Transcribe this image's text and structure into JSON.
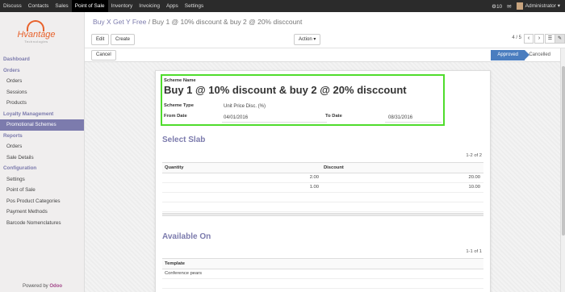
{
  "topbar": {
    "menu": [
      "Discuss",
      "Contacts",
      "Sales",
      "Point of Sale",
      "Inventory",
      "Invoicing",
      "Apps",
      "Settings"
    ],
    "active_index": 3,
    "notifications": "10",
    "user": "Administrator"
  },
  "logo": {
    "name": "Hvantage",
    "sub": "Technologies"
  },
  "sidebar": {
    "items": [
      {
        "label": "Dashboard",
        "kind": "section"
      },
      {
        "label": "Orders",
        "kind": "head"
      },
      {
        "label": "Orders",
        "kind": "item"
      },
      {
        "label": "Sessions",
        "kind": "item"
      },
      {
        "label": "Products",
        "kind": "item"
      },
      {
        "label": "Loyalty Management",
        "kind": "section"
      },
      {
        "label": "Promotional Schemes",
        "kind": "active"
      },
      {
        "label": "Reports",
        "kind": "section"
      },
      {
        "label": "Orders",
        "kind": "item"
      },
      {
        "label": "Sale Details",
        "kind": "item"
      },
      {
        "label": "Configuration",
        "kind": "section"
      },
      {
        "label": "Settings",
        "kind": "item"
      },
      {
        "label": "Point of Sale",
        "kind": "item"
      },
      {
        "label": "Pos Product Categories",
        "kind": "item"
      },
      {
        "label": "Payment Methods",
        "kind": "item"
      },
      {
        "label": "Barcode Nomenclatures",
        "kind": "item"
      }
    ],
    "powered_prefix": "Powered by",
    "powered_brand": "Odoo"
  },
  "breadcrumb": {
    "parent": "Buy X Get Y Free",
    "separator": "/",
    "current": "Buy 1 @ 10% discount & buy 2 @ 20% disccount"
  },
  "toolbar": {
    "edit": "Edit",
    "create": "Create",
    "action": "Action",
    "pager": "4 / 5"
  },
  "statusbar": {
    "cancel": "Cancel",
    "stages": [
      "Approved",
      "Cancelled"
    ],
    "current_stage": "Approved"
  },
  "form": {
    "scheme_name_label": "Scheme Name",
    "scheme_name": "Buy 1 @ 10% discount & buy 2 @ 20% disccount",
    "scheme_type_label": "Scheme Type",
    "scheme_type": "Unit Price Disc. (%)",
    "from_date_label": "From Date",
    "from_date": "04/01/2016",
    "to_date_label": "To Date",
    "to_date": "08/31/2016"
  },
  "slab": {
    "title": "Select Slab",
    "count": "1-2 of 2",
    "columns": [
      "Quantity",
      "Discount"
    ],
    "rows": [
      {
        "quantity": "2.00",
        "discount": "20.00"
      },
      {
        "quantity": "1.00",
        "discount": "10.00"
      }
    ]
  },
  "available": {
    "title": "Available On",
    "count": "1-1 of 1",
    "column": "Template",
    "rows": [
      "Conference pears"
    ]
  },
  "colors": {
    "accent": "#7c7bad",
    "highlight": "#4fdc2c",
    "approved": "#4a7dbf"
  }
}
